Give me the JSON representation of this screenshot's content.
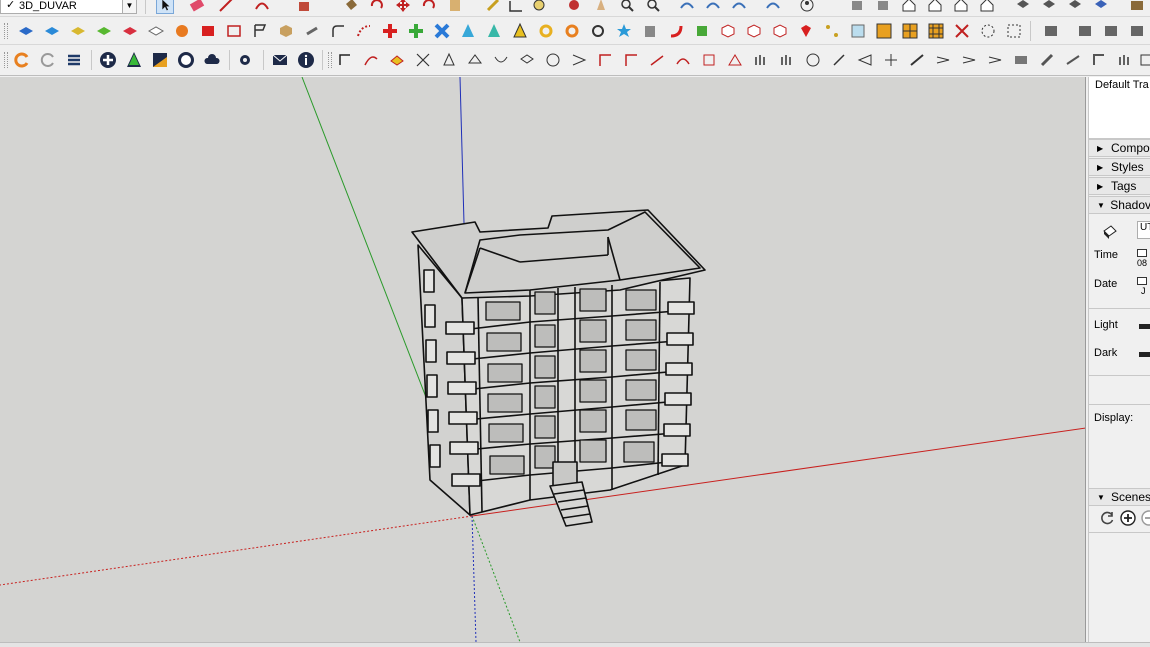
{
  "toolbar": {
    "tag_select": {
      "value": "3D_DUVAR",
      "checked": true
    }
  },
  "tray": {
    "title": "Default Tra",
    "panels": [
      {
        "label": "Compo",
        "expanded": false
      },
      {
        "label": "Styles",
        "expanded": false
      },
      {
        "label": "Tags",
        "expanded": false
      },
      {
        "label": "Shadov",
        "expanded": true
      }
    ],
    "shadows": {
      "timezone_value": "UT",
      "time_label": "Time",
      "time_value": "08",
      "date_label": "Date",
      "date_value": "J",
      "light_label": "Light",
      "dark_label": "Dark",
      "display_label": "Display:"
    },
    "scenes_panel": {
      "label": "Scenes",
      "expanded": true
    }
  },
  "viewport": {
    "background": "#d4d4d2",
    "axis_colors": {
      "red": "#c8201e",
      "green": "#2a9a2a",
      "blue": "#1f2fb8"
    },
    "model": "apartment-building"
  },
  "colors": {
    "accent": "#1e66c8"
  }
}
